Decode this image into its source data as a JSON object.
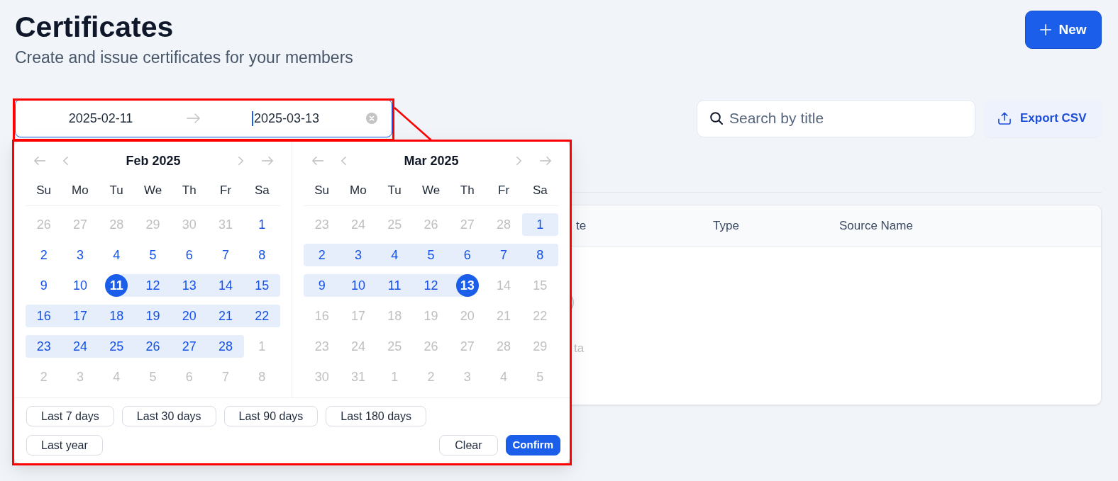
{
  "header": {
    "title": "Certificates",
    "subtitle": "Create and issue certificates for your members",
    "new_button": {
      "label": "New"
    }
  },
  "toolbar": {
    "date_range": {
      "highlighted": true,
      "start": {
        "value": "2025-02-11",
        "focused": false
      },
      "end": {
        "value": "2025-03-13",
        "focused": true
      }
    },
    "search": {
      "placeholder": "Search by title"
    },
    "export_button": {
      "label": "Export CSV"
    }
  },
  "table": {
    "columns": [
      "te",
      "Type",
      "Source Name"
    ],
    "empty_text": "ta"
  },
  "date_picker": {
    "highlighted": true,
    "months": [
      {
        "title": "Feb 2025",
        "weekdays": [
          "Su",
          "Mo",
          "Tu",
          "We",
          "Th",
          "Fr",
          "Sa"
        ],
        "weeks": [
          [
            {
              "day": "26",
              "muted": true,
              "in_range": false,
              "selected": false
            },
            {
              "day": "27",
              "muted": true,
              "in_range": false,
              "selected": false
            },
            {
              "day": "28",
              "muted": true,
              "in_range": false,
              "selected": false
            },
            {
              "day": "29",
              "muted": true,
              "in_range": false,
              "selected": false
            },
            {
              "day": "30",
              "muted": true,
              "in_range": false,
              "selected": false
            },
            {
              "day": "31",
              "muted": true,
              "in_range": false,
              "selected": false
            },
            {
              "day": "1",
              "muted": false,
              "in_range": false,
              "selected": false
            }
          ],
          [
            {
              "day": "2",
              "muted": false,
              "in_range": false,
              "selected": false
            },
            {
              "day": "3",
              "muted": false,
              "in_range": false,
              "selected": false
            },
            {
              "day": "4",
              "muted": false,
              "in_range": false,
              "selected": false
            },
            {
              "day": "5",
              "muted": false,
              "in_range": false,
              "selected": false
            },
            {
              "day": "6",
              "muted": false,
              "in_range": false,
              "selected": false
            },
            {
              "day": "7",
              "muted": false,
              "in_range": false,
              "selected": false
            },
            {
              "day": "8",
              "muted": false,
              "in_range": false,
              "selected": false
            }
          ],
          [
            {
              "day": "9",
              "muted": false,
              "in_range": false,
              "selected": false
            },
            {
              "day": "10",
              "muted": false,
              "in_range": false,
              "selected": false
            },
            {
              "day": "11",
              "muted": false,
              "in_range": true,
              "selected": true
            },
            {
              "day": "12",
              "muted": false,
              "in_range": true,
              "selected": false
            },
            {
              "day": "13",
              "muted": false,
              "in_range": true,
              "selected": false
            },
            {
              "day": "14",
              "muted": false,
              "in_range": true,
              "selected": false
            },
            {
              "day": "15",
              "muted": false,
              "in_range": true,
              "selected": false
            }
          ],
          [
            {
              "day": "16",
              "muted": false,
              "in_range": true,
              "selected": false
            },
            {
              "day": "17",
              "muted": false,
              "in_range": true,
              "selected": false
            },
            {
              "day": "18",
              "muted": false,
              "in_range": true,
              "selected": false
            },
            {
              "day": "19",
              "muted": false,
              "in_range": true,
              "selected": false
            },
            {
              "day": "20",
              "muted": false,
              "in_range": true,
              "selected": false
            },
            {
              "day": "21",
              "muted": false,
              "in_range": true,
              "selected": false
            },
            {
              "day": "22",
              "muted": false,
              "in_range": true,
              "selected": false
            }
          ],
          [
            {
              "day": "23",
              "muted": false,
              "in_range": true,
              "selected": false
            },
            {
              "day": "24",
              "muted": false,
              "in_range": true,
              "selected": false
            },
            {
              "day": "25",
              "muted": false,
              "in_range": true,
              "selected": false
            },
            {
              "day": "26",
              "muted": false,
              "in_range": true,
              "selected": false
            },
            {
              "day": "27",
              "muted": false,
              "in_range": true,
              "selected": false
            },
            {
              "day": "28",
              "muted": false,
              "in_range": true,
              "selected": false
            },
            {
              "day": "1",
              "muted": true,
              "in_range": false,
              "selected": false
            }
          ],
          [
            {
              "day": "2",
              "muted": true,
              "in_range": false,
              "selected": false
            },
            {
              "day": "3",
              "muted": true,
              "in_range": false,
              "selected": false
            },
            {
              "day": "4",
              "muted": true,
              "in_range": false,
              "selected": false
            },
            {
              "day": "5",
              "muted": true,
              "in_range": false,
              "selected": false
            },
            {
              "day": "6",
              "muted": true,
              "in_range": false,
              "selected": false
            },
            {
              "day": "7",
              "muted": true,
              "in_range": false,
              "selected": false
            },
            {
              "day": "8",
              "muted": true,
              "in_range": false,
              "selected": false
            }
          ]
        ]
      },
      {
        "title": "Mar 2025",
        "weekdays": [
          "Su",
          "Mo",
          "Tu",
          "We",
          "Th",
          "Fr",
          "Sa"
        ],
        "weeks": [
          [
            {
              "day": "23",
              "muted": true,
              "in_range": false,
              "selected": false
            },
            {
              "day": "24",
              "muted": true,
              "in_range": false,
              "selected": false
            },
            {
              "day": "25",
              "muted": true,
              "in_range": false,
              "selected": false
            },
            {
              "day": "26",
              "muted": true,
              "in_range": false,
              "selected": false
            },
            {
              "day": "27",
              "muted": true,
              "in_range": false,
              "selected": false
            },
            {
              "day": "28",
              "muted": true,
              "in_range": false,
              "selected": false
            },
            {
              "day": "1",
              "muted": false,
              "in_range": true,
              "selected": false
            }
          ],
          [
            {
              "day": "2",
              "muted": false,
              "in_range": true,
              "selected": false
            },
            {
              "day": "3",
              "muted": false,
              "in_range": true,
              "selected": false
            },
            {
              "day": "4",
              "muted": false,
              "in_range": true,
              "selected": false
            },
            {
              "day": "5",
              "muted": false,
              "in_range": true,
              "selected": false
            },
            {
              "day": "6",
              "muted": false,
              "in_range": true,
              "selected": false
            },
            {
              "day": "7",
              "muted": false,
              "in_range": true,
              "selected": false
            },
            {
              "day": "8",
              "muted": false,
              "in_range": true,
              "selected": false
            }
          ],
          [
            {
              "day": "9",
              "muted": false,
              "in_range": true,
              "selected": false
            },
            {
              "day": "10",
              "muted": false,
              "in_range": true,
              "selected": false
            },
            {
              "day": "11",
              "muted": false,
              "in_range": true,
              "selected": false
            },
            {
              "day": "12",
              "muted": false,
              "in_range": true,
              "selected": false
            },
            {
              "day": "13",
              "muted": false,
              "in_range": true,
              "selected": true
            },
            {
              "day": "14",
              "muted": true,
              "in_range": false,
              "selected": false
            },
            {
              "day": "15",
              "muted": true,
              "in_range": false,
              "selected": false
            }
          ],
          [
            {
              "day": "16",
              "muted": true,
              "in_range": false,
              "selected": false
            },
            {
              "day": "17",
              "muted": true,
              "in_range": false,
              "selected": false
            },
            {
              "day": "18",
              "muted": true,
              "in_range": false,
              "selected": false
            },
            {
              "day": "19",
              "muted": true,
              "in_range": false,
              "selected": false
            },
            {
              "day": "20",
              "muted": true,
              "in_range": false,
              "selected": false
            },
            {
              "day": "21",
              "muted": true,
              "in_range": false,
              "selected": false
            },
            {
              "day": "22",
              "muted": true,
              "in_range": false,
              "selected": false
            }
          ],
          [
            {
              "day": "23",
              "muted": true,
              "in_range": false,
              "selected": false
            },
            {
              "day": "24",
              "muted": true,
              "in_range": false,
              "selected": false
            },
            {
              "day": "25",
              "muted": true,
              "in_range": false,
              "selected": false
            },
            {
              "day": "26",
              "muted": true,
              "in_range": false,
              "selected": false
            },
            {
              "day": "27",
              "muted": true,
              "in_range": false,
              "selected": false
            },
            {
              "day": "28",
              "muted": true,
              "in_range": false,
              "selected": false
            },
            {
              "day": "29",
              "muted": true,
              "in_range": false,
              "selected": false
            }
          ],
          [
            {
              "day": "30",
              "muted": true,
              "in_range": false,
              "selected": false
            },
            {
              "day": "31",
              "muted": true,
              "in_range": false,
              "selected": false
            },
            {
              "day": "1",
              "muted": true,
              "in_range": false,
              "selected": false
            },
            {
              "day": "2",
              "muted": true,
              "in_range": false,
              "selected": false
            },
            {
              "day": "3",
              "muted": true,
              "in_range": false,
              "selected": false
            },
            {
              "day": "4",
              "muted": true,
              "in_range": false,
              "selected": false
            },
            {
              "day": "5",
              "muted": true,
              "in_range": false,
              "selected": false
            }
          ]
        ]
      }
    ],
    "presets": [
      "Last 7 days",
      "Last 30 days",
      "Last 90 days",
      "Last 180 days",
      "Last year"
    ],
    "actions": [
      {
        "label": "Clear",
        "kind": "reset"
      },
      {
        "label": "Confirm",
        "kind": "confirm"
      }
    ]
  }
}
